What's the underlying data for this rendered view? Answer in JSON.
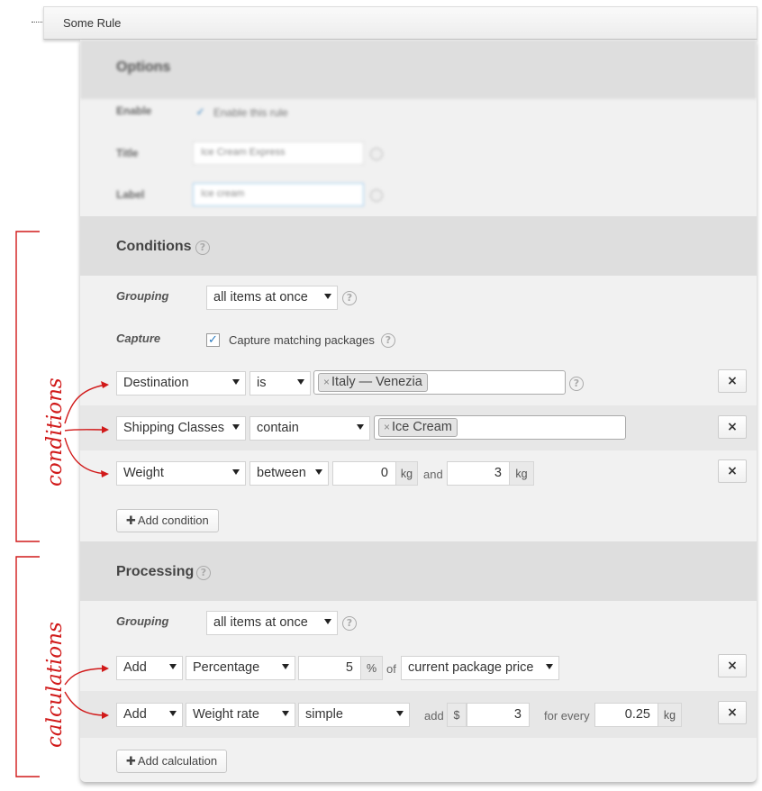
{
  "rule": {
    "title": "Some Rule"
  },
  "options": {
    "title": "Options",
    "enable_label": "Enable",
    "enable_text": "Enable this rule",
    "title_label": "Title",
    "title_value": "Ice Cream Express",
    "label_label": "Label",
    "label_value": "Ice cream"
  },
  "conditions": {
    "title": "Conditions",
    "help": "?",
    "grouping_label": "Grouping",
    "grouping_value": "all items at once",
    "capture_label": "Capture",
    "capture_checked": true,
    "capture_text": "Capture matching packages",
    "rows": [
      {
        "field": "Destination",
        "operator": "is",
        "tag_remove": "×",
        "tag": "Italy — Venezia"
      },
      {
        "field": "Shipping Classes",
        "operator": "contain",
        "tag_remove": "×",
        "tag": "Ice Cream"
      },
      {
        "field": "Weight",
        "operator": "between",
        "from": "0",
        "from_unit": "kg",
        "and": "and",
        "to": "3",
        "to_unit": "kg"
      }
    ],
    "delete_label": "×",
    "add_label": "Add condition"
  },
  "processing": {
    "title": "Processing",
    "help": "?",
    "grouping_label": "Grouping",
    "grouping_value": "all items at once",
    "rows": [
      {
        "action": "Add",
        "type": "Percentage",
        "value": "5",
        "unit": "%",
        "of": "of",
        "target": "current package price"
      },
      {
        "action": "Add",
        "type": "Weight rate",
        "mode": "simple",
        "add": "add",
        "currency": "$",
        "amount": "3",
        "for_every": "for every",
        "step": "0.25",
        "step_unit": "kg"
      }
    ],
    "delete_label": "×",
    "add_label": "Add calculation"
  },
  "annotations": {
    "conditions": "conditions",
    "calculations": "calculations",
    "color": "#d11a1a"
  },
  "icons": [
    "plus-icon",
    "help-icon",
    "close-icon",
    "caret-down-icon",
    "checkmark-icon"
  ]
}
